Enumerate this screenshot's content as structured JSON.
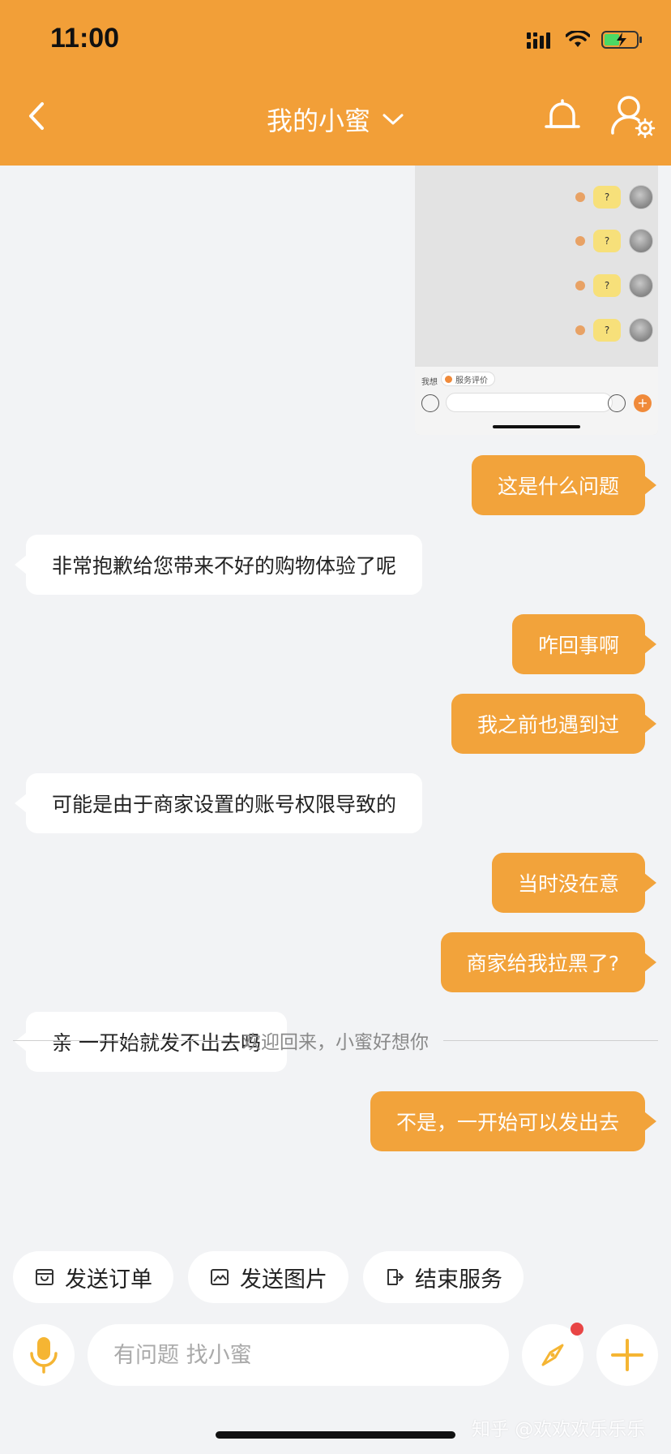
{
  "status_bar": {
    "time": "11:00"
  },
  "header": {
    "title": "我的小蜜"
  },
  "screenshot_preview": {
    "question_mark": "?",
    "bottom_label": "我想",
    "service_tag": "服务评价"
  },
  "messages": [
    {
      "side": "out",
      "text": "这是什么问题"
    },
    {
      "side": "in",
      "text": "非常抱歉给您带来不好的购物体验了呢"
    },
    {
      "side": "out",
      "text": "咋回事啊"
    },
    {
      "side": "out",
      "text": "我之前也遇到过"
    },
    {
      "side": "in",
      "text": "可能是由于商家设置的账号权限导致的"
    },
    {
      "side": "out",
      "text": "当时没在意"
    },
    {
      "side": "out",
      "text": "商家给我拉黑了?"
    },
    {
      "side": "in",
      "text": "亲 一开始就发不出去吗"
    },
    {
      "side": "out",
      "text": "不是，一开始可以发出去"
    }
  ],
  "divider_text": "欢迎回来，小蜜好想你",
  "quick_actions": [
    {
      "label": "发送订单",
      "icon": "order-icon"
    },
    {
      "label": "发送图片",
      "icon": "image-icon"
    },
    {
      "label": "结束服务",
      "icon": "exit-icon"
    }
  ],
  "input": {
    "placeholder": "有问题 找小蜜"
  },
  "watermark": "知乎 @欢欢欢乐乐乐",
  "colors": {
    "accent": "#f29f38",
    "bubble_out": "#f2a33b",
    "background": "#f2f3f5",
    "badge": "#e84545"
  }
}
